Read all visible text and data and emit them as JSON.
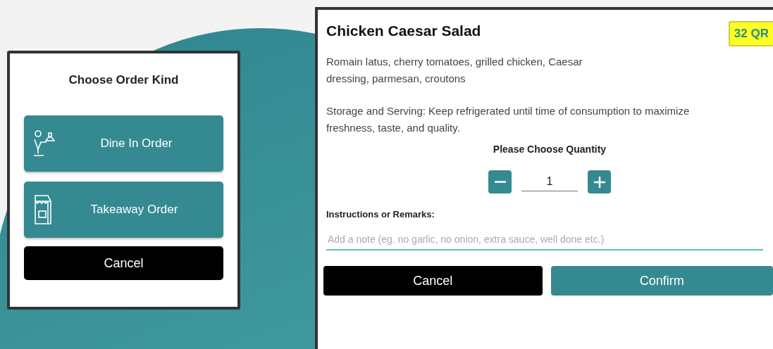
{
  "order_kind_dialog": {
    "title": "Choose Order Kind",
    "options": [
      {
        "kind": "dine_in",
        "label": "Dine In Order"
      },
      {
        "kind": "takeaway",
        "label": "Takeaway Order"
      }
    ],
    "cancel_button": "Cancel"
  },
  "item_dialog": {
    "title": "Chicken Caesar Salad",
    "price": "32 QR",
    "description": "Romain latus, cherry tomatoes, grilled chicken, Caesar dressing, parmesan, croutons",
    "storage_note": "Storage and Serving: Keep refrigerated until time of consumption to maximize freshness, taste, and quality.",
    "quantity_label": "Please Choose Quantity",
    "quantity": "1",
    "remarks_label": "Instructions or Remarks:",
    "remarks_placeholder": "Add a note (eg. no garlic, no onion, extra sauce, well done etc.)",
    "cancel_button": "Cancel",
    "confirm_button": "Confirm"
  }
}
